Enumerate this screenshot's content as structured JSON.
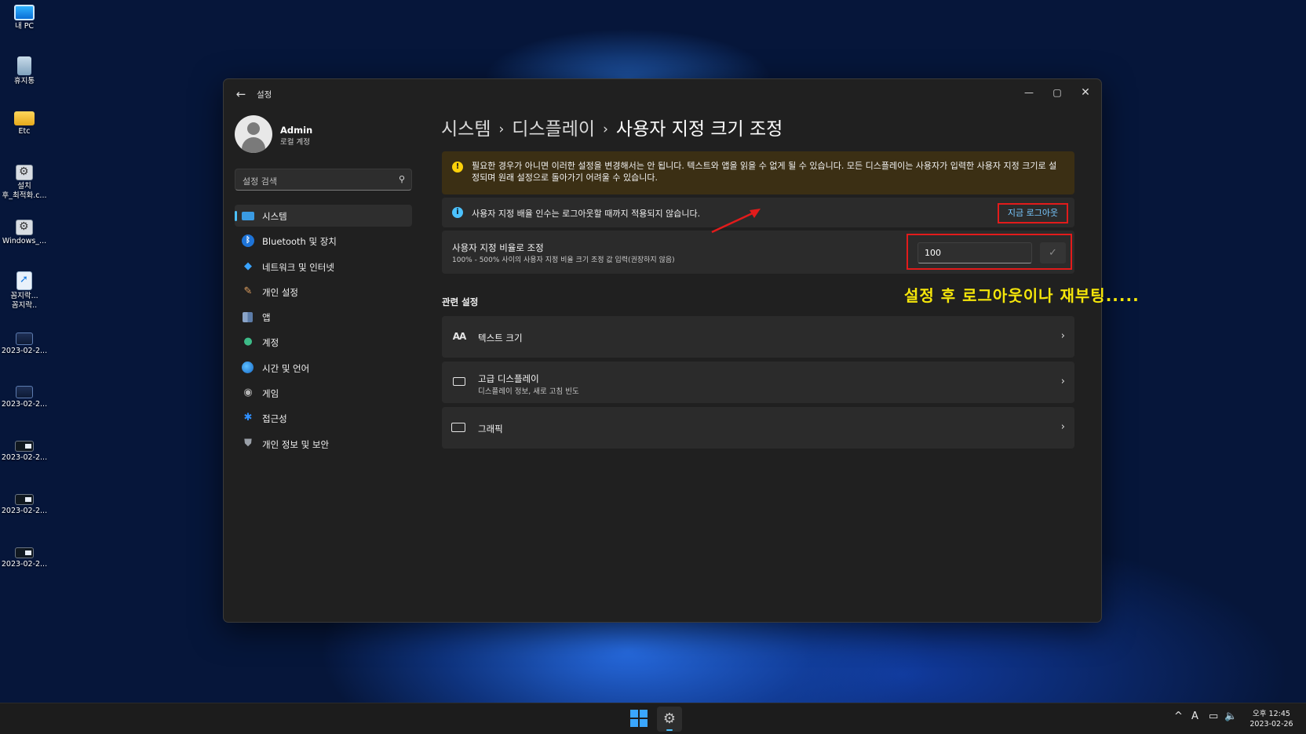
{
  "desktop": {
    "icons": [
      {
        "label": "내 PC",
        "icon": "computer-icon"
      },
      {
        "label": "휴지통",
        "icon": "recycle-bin-icon"
      },
      {
        "label": "Etc",
        "icon": "folder-icon"
      },
      {
        "label": "설치\n후_최적화.c...",
        "icon": "settings-shortcut-icon"
      },
      {
        "label": "Windows_...",
        "icon": "settings-shortcut-icon"
      },
      {
        "label": "꼼지락...\n꼼지락..",
        "icon": "document-shortcut-icon"
      },
      {
        "label": "2023-02-2...",
        "icon": "screenshot-icon"
      },
      {
        "label": "2023-02-2...",
        "icon": "screenshot-icon"
      },
      {
        "label": "2023-02-2...",
        "icon": "screenshot-icon"
      },
      {
        "label": "2023-02-2...",
        "icon": "screenshot-icon"
      },
      {
        "label": "2023-02-2...",
        "icon": "screenshot-icon"
      }
    ]
  },
  "window": {
    "title": "설정",
    "controls": {
      "minimize": "—",
      "maximize": "▢",
      "close": "✕"
    }
  },
  "profile": {
    "name": "Admin",
    "account_type": "로컬 계정"
  },
  "search": {
    "placeholder": "설정 검색"
  },
  "nav": {
    "items": [
      {
        "label": "시스템",
        "icon": "system-icon",
        "active": true
      },
      {
        "label": "Bluetooth 및 장치",
        "icon": "bluetooth-icon"
      },
      {
        "label": "네트워크 및 인터넷",
        "icon": "network-icon"
      },
      {
        "label": "개인 설정",
        "icon": "brush-icon"
      },
      {
        "label": "앱",
        "icon": "apps-icon"
      },
      {
        "label": "계정",
        "icon": "account-icon"
      },
      {
        "label": "시간 및 언어",
        "icon": "globe-clock-icon"
      },
      {
        "label": "게임",
        "icon": "gamepad-icon"
      },
      {
        "label": "접근성",
        "icon": "accessibility-icon"
      },
      {
        "label": "개인 정보 및 보안",
        "icon": "shield-icon"
      }
    ]
  },
  "breadcrumb": {
    "part1": "시스템",
    "part2": "디스플레이",
    "current": "사용자 지정 크기 조정",
    "separator": "›"
  },
  "warning": {
    "text": "필요한 경우가 아니면 이러한 설정을 변경해서는 안 됩니다. 텍스트와 앱을 읽을 수 없게 될 수 있습니다. 모든 디스플레이는 사용자가 입력한 사용자 지정 크기로 설정되며 원래 설정으로 돌아가기 어려울 수 있습니다."
  },
  "info": {
    "text": "사용자 지정 배율 인수는 로그아웃할 때까지 적용되지 않습니다.",
    "logout_label": "지금 로그아웃"
  },
  "scale": {
    "title": "사용자 지정 비율로 조정",
    "description": "100% - 500% 사이의 사용자 지정 비율 크기 조정 값 입력(권장하지 않음)",
    "value": "100",
    "apply_icon": "✓"
  },
  "annotation": "설정 후 로그아웃이나 재부팅.....",
  "related": {
    "title": "관련 설정",
    "items": [
      {
        "title": "텍스트 크기",
        "sub": "",
        "icon": "text-size-icon"
      },
      {
        "title": "고급 디스플레이",
        "sub": "디스플레이 정보, 새로 고침 빈도",
        "icon": "monitor-icon"
      },
      {
        "title": "그래픽",
        "sub": "",
        "icon": "gpu-icon"
      }
    ]
  },
  "taskbar": {
    "clock_time": "오후 12:45",
    "clock_date": "2023-02-26",
    "ime": "A",
    "chevron": "^"
  },
  "colors": {
    "accent": "#4cc2ff",
    "annotation_yellow": "#f5e60a",
    "highlight_red": "#e21b1b",
    "warning_bg": "#3b2f14"
  }
}
